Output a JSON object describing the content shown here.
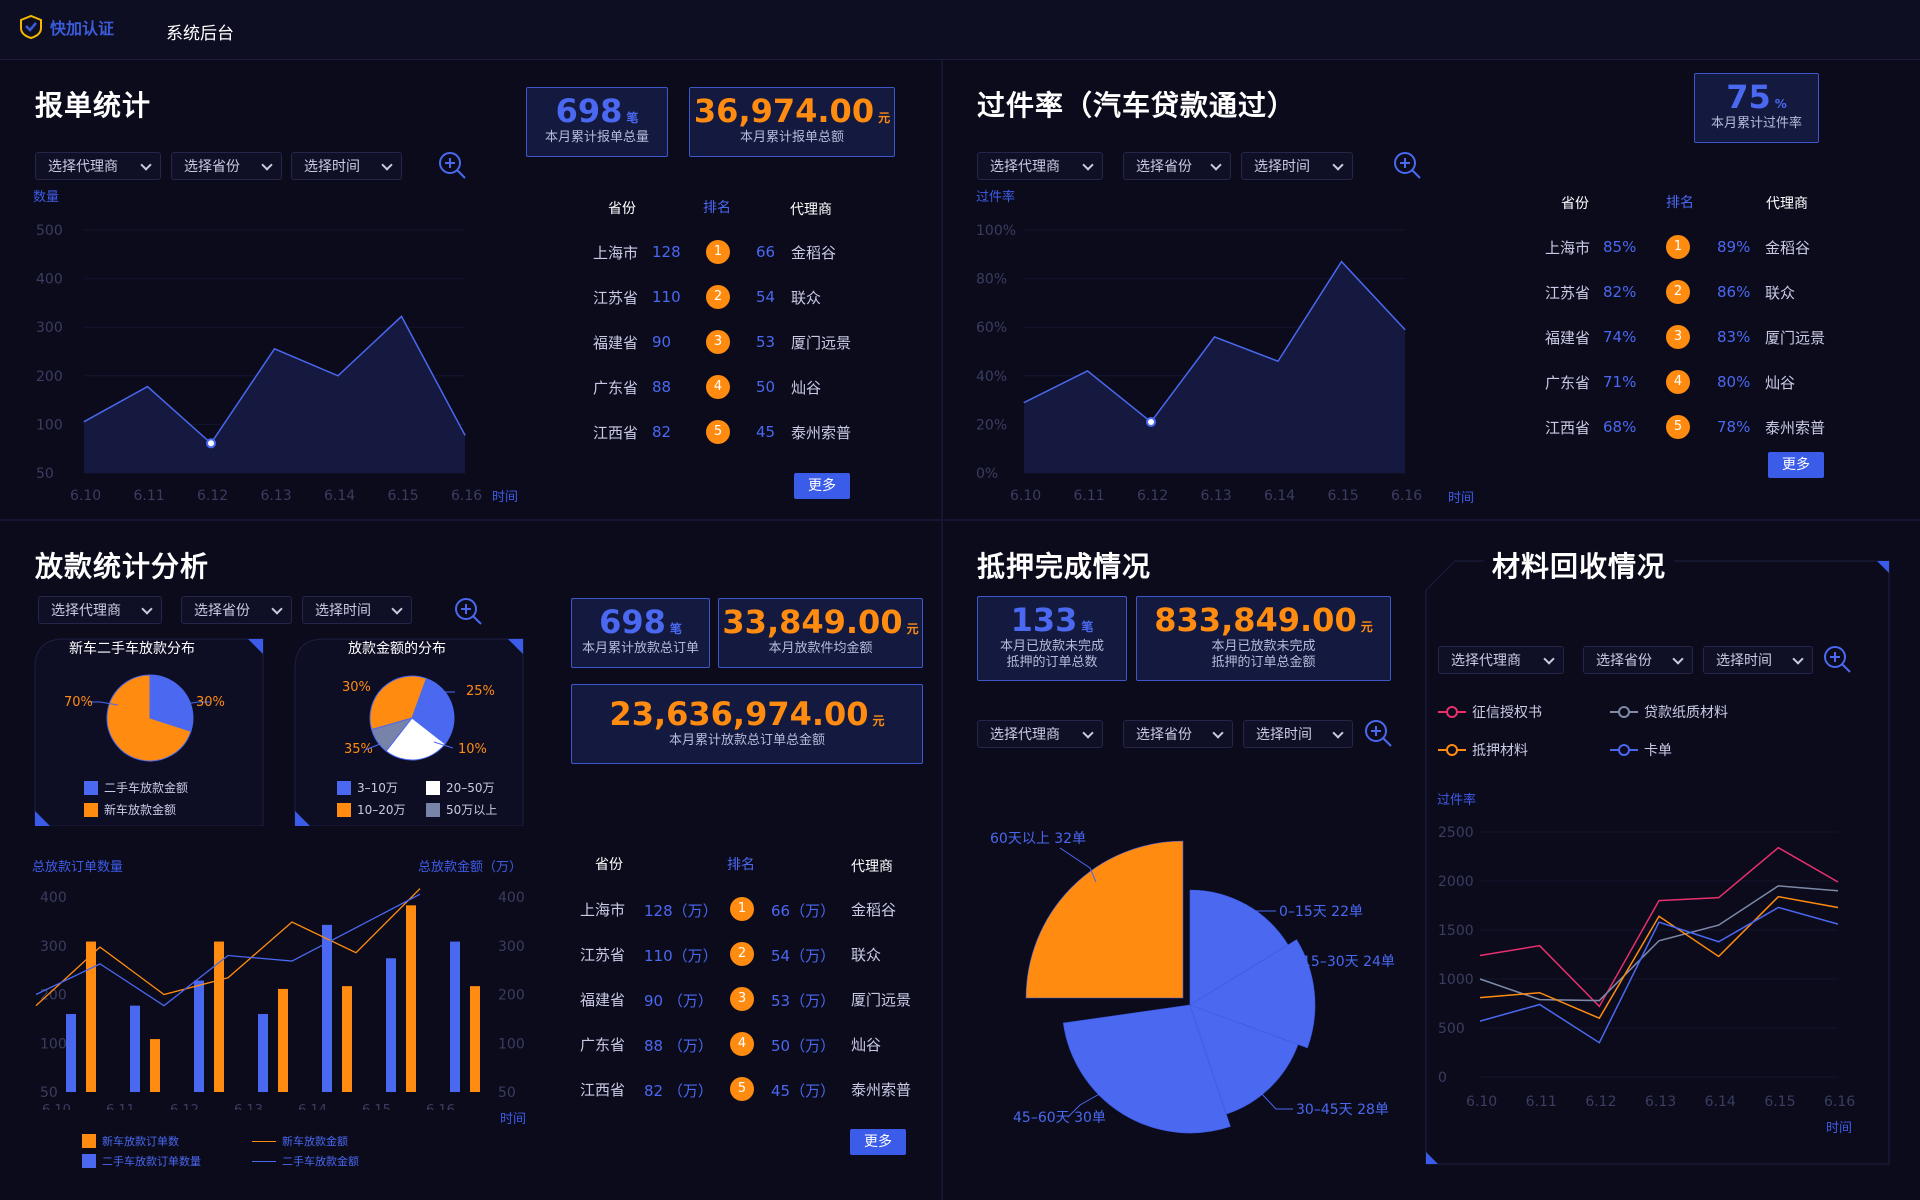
{
  "header": {
    "logo_text": "快加认证",
    "title": "系统后台"
  },
  "filters": {
    "agent": "选择代理商",
    "province": "选择省份",
    "time": "选择时间"
  },
  "report": {
    "title": "报单统计",
    "kpi1": {
      "value": "698",
      "unit": "笔",
      "caption": "本月累计报单总量"
    },
    "kpi2": {
      "value": "36,974.00",
      "unit": "元",
      "caption": "本月累计报单总额"
    },
    "ylabel": "数量",
    "xlabel": "时间",
    "table_head": [
      "省份",
      "排名",
      "代理商"
    ],
    "rows": [
      {
        "province": "上海市",
        "v1": "128",
        "rank": "1",
        "v2": "66",
        "agent": "金稻谷"
      },
      {
        "province": "江苏省",
        "v1": "110",
        "rank": "2",
        "v2": "54",
        "agent": "联众"
      },
      {
        "province": "福建省",
        "v1": "90",
        "rank": "3",
        "v2": "53",
        "agent": "厦门远景"
      },
      {
        "province": "广东省",
        "v1": "88",
        "rank": "4",
        "v2": "50",
        "agent": "灿谷"
      },
      {
        "province": "江西省",
        "v1": "82",
        "rank": "5",
        "v2": "45",
        "agent": "泰州索普"
      }
    ],
    "more": "更多"
  },
  "passrate": {
    "title": "过件率（汽车贷款通过）",
    "kpi": {
      "value": "75",
      "unit": "%",
      "caption": "本月累计过件率"
    },
    "ylabel": "过件率",
    "xlabel": "时间",
    "table_head": [
      "省份",
      "排名",
      "代理商"
    ],
    "rows": [
      {
        "province": "上海市",
        "v1": "85%",
        "rank": "1",
        "v2": "89%",
        "agent": "金稻谷"
      },
      {
        "province": "江苏省",
        "v1": "82%",
        "rank": "2",
        "v2": "86%",
        "agent": "联众"
      },
      {
        "province": "福建省",
        "v1": "74%",
        "rank": "3",
        "v2": "83%",
        "agent": "厦门远景"
      },
      {
        "province": "广东省",
        "v1": "71%",
        "rank": "4",
        "v2": "80%",
        "agent": "灿谷"
      },
      {
        "province": "江西省",
        "v1": "68%",
        "rank": "5",
        "v2": "78%",
        "agent": "泰州索普"
      }
    ],
    "more": "更多"
  },
  "loan": {
    "title": "放款统计分析",
    "pie1_title": "新车二手车放款分布",
    "pie2_title": "放款金额的分布",
    "pie1_legend": [
      "二手车放款金额",
      "新车放款金额"
    ],
    "pie2_legend": [
      "3–10万",
      "20–50万",
      "10–20万",
      "50万以上"
    ],
    "kpi1": {
      "value": "698",
      "unit": "笔",
      "caption": "本月累计放款总订单"
    },
    "kpi2": {
      "value": "33,849.00",
      "unit": "元",
      "caption": "本月放款件均金额"
    },
    "kpi3": {
      "value": "23,636,974.00",
      "unit": "元",
      "caption": "本月累计放款总订单总金额"
    },
    "left_axis_title": "总放款订单数量",
    "right_axis_title": "总放款金额（万）",
    "xlabel": "时间",
    "bar_legend": [
      "新车放款订单数",
      "新车放款金额",
      "二手车放款订单数量",
      "二手车放款金额"
    ],
    "table_head": [
      "省份",
      "排名",
      "代理商"
    ],
    "rows": [
      {
        "province": "上海市",
        "v1": "128（万）",
        "rank": "1",
        "v2": "66（万）",
        "agent": "金稻谷"
      },
      {
        "province": "江苏省",
        "v1": "110（万）",
        "rank": "2",
        "v2": "54（万）",
        "agent": "联众"
      },
      {
        "province": "福建省",
        "v1": "90 （万）",
        "rank": "3",
        "v2": "53（万）",
        "agent": "厦门远景"
      },
      {
        "province": "广东省",
        "v1": "88 （万）",
        "rank": "4",
        "v2": "50（万）",
        "agent": "灿谷"
      },
      {
        "province": "江西省",
        "v1": "82 （万）",
        "rank": "5",
        "v2": "45（万）",
        "agent": "泰州索普"
      }
    ],
    "more": "更多"
  },
  "mortgage": {
    "title": "抵押完成情况",
    "kpi1": {
      "value": "133",
      "unit": "笔",
      "caption1": "本月已放款未完成",
      "caption2": "抵押的订单总数"
    },
    "kpi2": {
      "value": "833,849.00",
      "unit": "元",
      "caption1": "本月已放款未完成",
      "caption2": "抵押的订单总金额"
    }
  },
  "material": {
    "title": "材料回收情况",
    "legend": [
      "征信授权书",
      "贷款纸质材料",
      "抵押材料",
      "卡单"
    ],
    "ylabel": "过件率",
    "xlabel": "时间"
  },
  "chart_data": [
    {
      "type": "area",
      "categories": [
        "6.10",
        "6.11",
        "6.12",
        "6.13",
        "6.14",
        "6.15",
        "6.16"
      ],
      "values": [
        145,
        210,
        105,
        280,
        230,
        340,
        120
      ],
      "yticks": [
        "500",
        "400",
        "300",
        "200",
        "100",
        "50"
      ],
      "ylim": [
        50,
        500
      ],
      "ylabel": "数量",
      "xlabel": "时间"
    },
    {
      "type": "area",
      "categories": [
        "6.10",
        "6.11",
        "6.12",
        "6.13",
        "6.14",
        "6.15",
        "6.16"
      ],
      "values": [
        29,
        42,
        21,
        56,
        46,
        87,
        59
      ],
      "yticks": [
        "100%",
        "80%",
        "60%",
        "40%",
        "20%",
        "0%"
      ],
      "ylim": [
        0,
        100
      ],
      "ylabel": "过件率",
      "xlabel": "时间"
    },
    {
      "type": "pie",
      "title": "新车二手车放款分布",
      "labels": [
        "二手车放款金额",
        "新车放款金额"
      ],
      "values": [
        30,
        70
      ],
      "value_labels": [
        "30%",
        "70%"
      ],
      "colors": [
        "#4a68f0",
        "#ff8c10"
      ]
    },
    {
      "type": "pie",
      "title": "放款金额的分布",
      "labels": [
        "3–10万",
        "20–50万",
        "50万以上",
        "10–20万"
      ],
      "values": [
        30,
        25,
        10,
        35
      ],
      "value_labels": [
        "30%",
        "25%",
        "10%",
        "35%"
      ],
      "colors": [
        "#4a68f0",
        "#ffffff",
        "#7783a8",
        "#ff8c10"
      ]
    },
    {
      "type": "bar",
      "categories": [
        "6.10",
        "6.11",
        "6.12",
        "6.13",
        "6.14",
        "6.15",
        "6.16"
      ],
      "series": [
        {
          "name": "二手车放款订单数量",
          "values": [
            190,
            205,
            250,
            190,
            350,
            290,
            320
          ]
        },
        {
          "name": "新车放款订单数",
          "values": [
            320,
            145,
            320,
            235,
            240,
            385,
            240
          ]
        },
        {
          "name": "新车放款金额",
          "values": [
            205,
            310,
            225,
            255,
            355,
            300,
            415
          ]
        },
        {
          "name": "二手车放款金额",
          "values": [
            225,
            280,
            205,
            295,
            285,
            345,
            405
          ]
        }
      ],
      "yticks_left": [
        "400",
        "300",
        "200",
        "100",
        "50"
      ],
      "yticks_right": [
        "400",
        "300",
        "200",
        "100",
        "50"
      ],
      "ylim": [
        50,
        400
      ]
    },
    {
      "type": "pie",
      "labels": [
        "60天以上 32单",
        "0–15天 22单",
        "15–30天 24单",
        "30–45天 28单",
        "45–60天 30单"
      ],
      "values": [
        32,
        22,
        24,
        28,
        30
      ],
      "colors": [
        "#ff8c10",
        "#4a68f0",
        "#4a68f0",
        "#4a68f0",
        "#4a68f0"
      ]
    },
    {
      "type": "line",
      "categories": [
        "6.10",
        "6.11",
        "6.12",
        "6.13",
        "6.14",
        "6.15",
        "6.16"
      ],
      "series": [
        {
          "name": "征信授权书",
          "values": [
            1240,
            1340,
            720,
            1800,
            1830,
            2340,
            1990
          ],
          "color": "#e8306d"
        },
        {
          "name": "贷款纸质材料",
          "values": [
            1000,
            790,
            780,
            1390,
            1550,
            1950,
            1900
          ],
          "color": "#7e8aa8"
        },
        {
          "name": "抵押材料",
          "values": [
            810,
            860,
            600,
            1640,
            1230,
            1840,
            1730
          ],
          "color": "#ff8c10"
        },
        {
          "name": "卡单",
          "values": [
            570,
            740,
            350,
            1580,
            1380,
            1730,
            1560
          ],
          "color": "#4a68f0"
        }
      ],
      "yticks": [
        "2500",
        "2000",
        "1500",
        "1000",
        "500",
        "0"
      ],
      "ylim": [
        0,
        2500
      ],
      "ylabel": "过件率",
      "xlabel": "时间"
    }
  ]
}
